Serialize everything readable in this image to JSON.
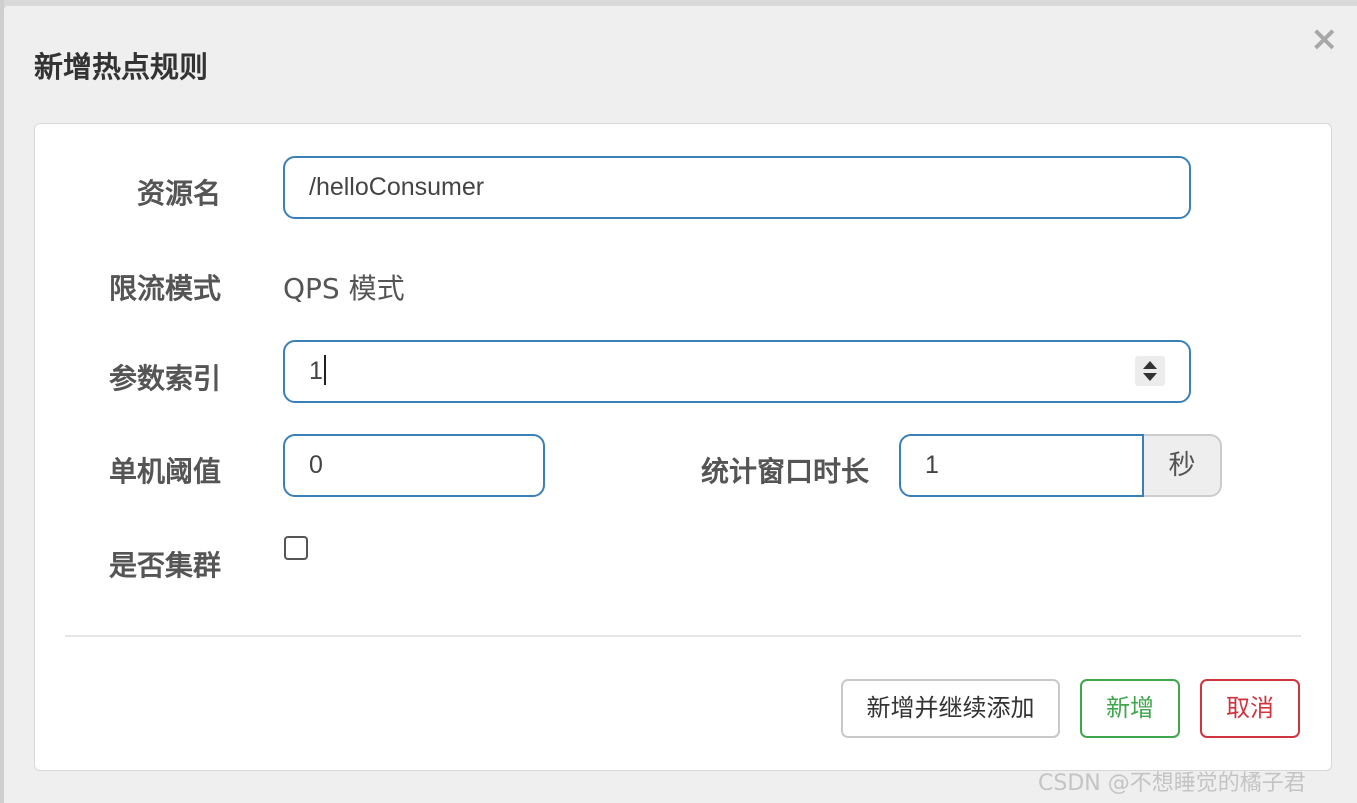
{
  "dialog": {
    "title": "新增热点规则",
    "close_glyph": "×"
  },
  "form": {
    "resource_name": {
      "label": "资源名",
      "value": "/helloConsumer"
    },
    "limit_mode": {
      "label": "限流模式",
      "value": "QPS 模式"
    },
    "param_index": {
      "label": "参数索引",
      "value": "1"
    },
    "threshold": {
      "label": "单机阈值",
      "value": "0"
    },
    "stat_window": {
      "label": "统计窗口时长",
      "value": "1",
      "unit": "秒"
    },
    "cluster_mode": {
      "label": "是否集群",
      "checked": false
    }
  },
  "buttons": {
    "add_continue": "新增并继续添加",
    "add": "新增",
    "cancel": "取消"
  },
  "watermark": "CSDN @不想睡觉的橘子君",
  "colors": {
    "input_border": "#3b7fb8",
    "success": "#3fa64c",
    "danger": "#d0343f"
  }
}
